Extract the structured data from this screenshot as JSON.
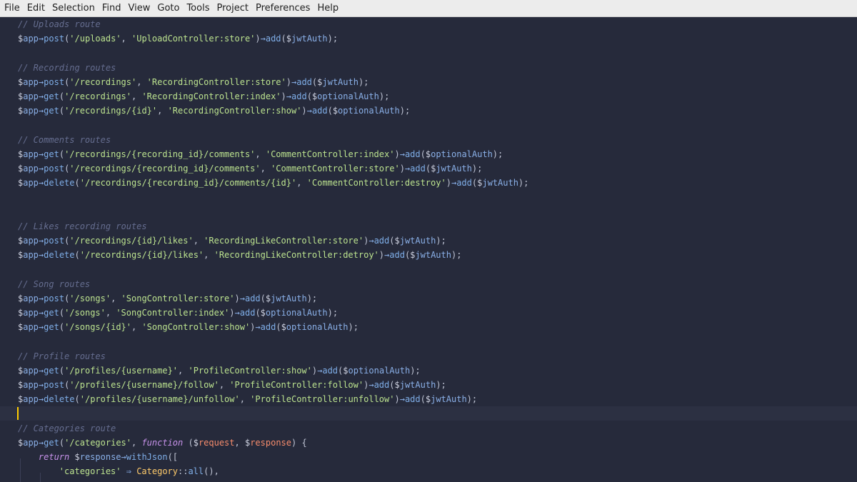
{
  "menu": [
    "File",
    "Edit",
    "Selection",
    "Find",
    "View",
    "Goto",
    "Tools",
    "Project",
    "Preferences",
    "Help"
  ],
  "colors": {
    "background": "#262a3b",
    "menubar": "#ececec",
    "comment": "#656d8f",
    "string": "#bce38f",
    "function": "#7faee8",
    "keyword": "#c792ea",
    "class": "#ffcb6b",
    "parameter": "#f78c6c",
    "cursor": "#ffcc00"
  },
  "code": [
    [
      [
        "c",
        "// Uploads route"
      ]
    ],
    [
      [
        "d",
        "$"
      ],
      [
        "v",
        "app"
      ],
      [
        "a",
        "→"
      ],
      [
        "f",
        "post"
      ],
      [
        "p",
        "("
      ],
      [
        "s",
        "'/uploads'"
      ],
      [
        "p",
        ", "
      ],
      [
        "s",
        "'UploadController:store'"
      ],
      [
        "p",
        ")"
      ],
      [
        "a",
        "→"
      ],
      [
        "f",
        "add"
      ],
      [
        "p",
        "("
      ],
      [
        "d",
        "$"
      ],
      [
        "v",
        "jwtAuth"
      ],
      [
        "p",
        ");"
      ]
    ],
    [],
    [
      [
        "c",
        "// Recording routes"
      ]
    ],
    [
      [
        "d",
        "$"
      ],
      [
        "v",
        "app"
      ],
      [
        "a",
        "→"
      ],
      [
        "f",
        "post"
      ],
      [
        "p",
        "("
      ],
      [
        "s",
        "'/recordings'"
      ],
      [
        "p",
        ", "
      ],
      [
        "s",
        "'RecordingController:store'"
      ],
      [
        "p",
        ")"
      ],
      [
        "a",
        "→"
      ],
      [
        "f",
        "add"
      ],
      [
        "p",
        "("
      ],
      [
        "d",
        "$"
      ],
      [
        "v",
        "jwtAuth"
      ],
      [
        "p",
        ");"
      ]
    ],
    [
      [
        "d",
        "$"
      ],
      [
        "v",
        "app"
      ],
      [
        "a",
        "→"
      ],
      [
        "f",
        "get"
      ],
      [
        "p",
        "("
      ],
      [
        "s",
        "'/recordings'"
      ],
      [
        "p",
        ", "
      ],
      [
        "s",
        "'RecordingController:index'"
      ],
      [
        "p",
        ")"
      ],
      [
        "a",
        "→"
      ],
      [
        "f",
        "add"
      ],
      [
        "p",
        "("
      ],
      [
        "d",
        "$"
      ],
      [
        "v",
        "optionalAuth"
      ],
      [
        "p",
        ");"
      ]
    ],
    [
      [
        "d",
        "$"
      ],
      [
        "v",
        "app"
      ],
      [
        "a",
        "→"
      ],
      [
        "f",
        "get"
      ],
      [
        "p",
        "("
      ],
      [
        "s",
        "'/recordings/{id}'"
      ],
      [
        "p",
        ", "
      ],
      [
        "s",
        "'RecordingController:show'"
      ],
      [
        "p",
        ")"
      ],
      [
        "a",
        "→"
      ],
      [
        "f",
        "add"
      ],
      [
        "p",
        "("
      ],
      [
        "d",
        "$"
      ],
      [
        "v",
        "optionalAuth"
      ],
      [
        "p",
        ");"
      ]
    ],
    [],
    [
      [
        "c",
        "// Comments routes"
      ]
    ],
    [
      [
        "d",
        "$"
      ],
      [
        "v",
        "app"
      ],
      [
        "a",
        "→"
      ],
      [
        "f",
        "get"
      ],
      [
        "p",
        "("
      ],
      [
        "s",
        "'/recordings/{recording_id}/comments'"
      ],
      [
        "p",
        ", "
      ],
      [
        "s",
        "'CommentController:index'"
      ],
      [
        "p",
        ")"
      ],
      [
        "a",
        "→"
      ],
      [
        "f",
        "add"
      ],
      [
        "p",
        "("
      ],
      [
        "d",
        "$"
      ],
      [
        "v",
        "optionalAuth"
      ],
      [
        "p",
        ");"
      ]
    ],
    [
      [
        "d",
        "$"
      ],
      [
        "v",
        "app"
      ],
      [
        "a",
        "→"
      ],
      [
        "f",
        "post"
      ],
      [
        "p",
        "("
      ],
      [
        "s",
        "'/recordings/{recording_id}/comments'"
      ],
      [
        "p",
        ", "
      ],
      [
        "s",
        "'CommentController:store'"
      ],
      [
        "p",
        ")"
      ],
      [
        "a",
        "→"
      ],
      [
        "f",
        "add"
      ],
      [
        "p",
        "("
      ],
      [
        "d",
        "$"
      ],
      [
        "v",
        "jwtAuth"
      ],
      [
        "p",
        ");"
      ]
    ],
    [
      [
        "d",
        "$"
      ],
      [
        "v",
        "app"
      ],
      [
        "a",
        "→"
      ],
      [
        "f",
        "delete"
      ],
      [
        "p",
        "("
      ],
      [
        "s",
        "'/recordings/{recording_id}/comments/{id}'"
      ],
      [
        "p",
        ", "
      ],
      [
        "s",
        "'CommentController:destroy'"
      ],
      [
        "p",
        ")"
      ],
      [
        "a",
        "→"
      ],
      [
        "f",
        "add"
      ],
      [
        "p",
        "("
      ],
      [
        "d",
        "$"
      ],
      [
        "v",
        "jwtAuth"
      ],
      [
        "p",
        ");"
      ]
    ],
    [],
    [],
    [
      [
        "c",
        "// Likes recording routes"
      ]
    ],
    [
      [
        "d",
        "$"
      ],
      [
        "v",
        "app"
      ],
      [
        "a",
        "→"
      ],
      [
        "f",
        "post"
      ],
      [
        "p",
        "("
      ],
      [
        "s",
        "'/recordings/{id}/likes'"
      ],
      [
        "p",
        ", "
      ],
      [
        "s",
        "'RecordingLikeController:store'"
      ],
      [
        "p",
        ")"
      ],
      [
        "a",
        "→"
      ],
      [
        "f",
        "add"
      ],
      [
        "p",
        "("
      ],
      [
        "d",
        "$"
      ],
      [
        "v",
        "jwtAuth"
      ],
      [
        "p",
        ");"
      ]
    ],
    [
      [
        "d",
        "$"
      ],
      [
        "v",
        "app"
      ],
      [
        "a",
        "→"
      ],
      [
        "f",
        "delete"
      ],
      [
        "p",
        "("
      ],
      [
        "s",
        "'/recordings/{id}/likes'"
      ],
      [
        "p",
        ", "
      ],
      [
        "s",
        "'RecordingLikeController:detroy'"
      ],
      [
        "p",
        ")"
      ],
      [
        "a",
        "→"
      ],
      [
        "f",
        "add"
      ],
      [
        "p",
        "("
      ],
      [
        "d",
        "$"
      ],
      [
        "v",
        "jwtAuth"
      ],
      [
        "p",
        ");"
      ]
    ],
    [],
    [
      [
        "c",
        "// Song routes"
      ]
    ],
    [
      [
        "d",
        "$"
      ],
      [
        "v",
        "app"
      ],
      [
        "a",
        "→"
      ],
      [
        "f",
        "post"
      ],
      [
        "p",
        "("
      ],
      [
        "s",
        "'/songs'"
      ],
      [
        "p",
        ", "
      ],
      [
        "s",
        "'SongController:store'"
      ],
      [
        "p",
        ")"
      ],
      [
        "a",
        "→"
      ],
      [
        "f",
        "add"
      ],
      [
        "p",
        "("
      ],
      [
        "d",
        "$"
      ],
      [
        "v",
        "jwtAuth"
      ],
      [
        "p",
        ");"
      ]
    ],
    [
      [
        "d",
        "$"
      ],
      [
        "v",
        "app"
      ],
      [
        "a",
        "→"
      ],
      [
        "f",
        "get"
      ],
      [
        "p",
        "("
      ],
      [
        "s",
        "'/songs'"
      ],
      [
        "p",
        ", "
      ],
      [
        "s",
        "'SongController:index'"
      ],
      [
        "p",
        ")"
      ],
      [
        "a",
        "→"
      ],
      [
        "f",
        "add"
      ],
      [
        "p",
        "("
      ],
      [
        "d",
        "$"
      ],
      [
        "v",
        "optionalAuth"
      ],
      [
        "p",
        ");"
      ]
    ],
    [
      [
        "d",
        "$"
      ],
      [
        "v",
        "app"
      ],
      [
        "a",
        "→"
      ],
      [
        "f",
        "get"
      ],
      [
        "p",
        "("
      ],
      [
        "s",
        "'/songs/{id}'"
      ],
      [
        "p",
        ", "
      ],
      [
        "s",
        "'SongController:show'"
      ],
      [
        "p",
        ")"
      ],
      [
        "a",
        "→"
      ],
      [
        "f",
        "add"
      ],
      [
        "p",
        "("
      ],
      [
        "d",
        "$"
      ],
      [
        "v",
        "optionalAuth"
      ],
      [
        "p",
        ");"
      ]
    ],
    [],
    [
      [
        "c",
        "// Profile routes"
      ]
    ],
    [
      [
        "d",
        "$"
      ],
      [
        "v",
        "app"
      ],
      [
        "a",
        "→"
      ],
      [
        "f",
        "get"
      ],
      [
        "p",
        "("
      ],
      [
        "s",
        "'/profiles/{username}'"
      ],
      [
        "p",
        ", "
      ],
      [
        "s",
        "'ProfileController:show'"
      ],
      [
        "p",
        ")"
      ],
      [
        "a",
        "→"
      ],
      [
        "f",
        "add"
      ],
      [
        "p",
        "("
      ],
      [
        "d",
        "$"
      ],
      [
        "v",
        "optionalAuth"
      ],
      [
        "p",
        ");"
      ]
    ],
    [
      [
        "d",
        "$"
      ],
      [
        "v",
        "app"
      ],
      [
        "a",
        "→"
      ],
      [
        "f",
        "post"
      ],
      [
        "p",
        "("
      ],
      [
        "s",
        "'/profiles/{username}/follow'"
      ],
      [
        "p",
        ", "
      ],
      [
        "s",
        "'ProfileController:follow'"
      ],
      [
        "p",
        ")"
      ],
      [
        "a",
        "→"
      ],
      [
        "f",
        "add"
      ],
      [
        "p",
        "("
      ],
      [
        "d",
        "$"
      ],
      [
        "v",
        "jwtAuth"
      ],
      [
        "p",
        ");"
      ]
    ],
    [
      [
        "d",
        "$"
      ],
      [
        "v",
        "app"
      ],
      [
        "a",
        "→"
      ],
      [
        "f",
        "delete"
      ],
      [
        "p",
        "("
      ],
      [
        "s",
        "'/profiles/{username}/unfollow'"
      ],
      [
        "p",
        ", "
      ],
      [
        "s",
        "'ProfileController:unfollow'"
      ],
      [
        "p",
        ")"
      ],
      [
        "a",
        "→"
      ],
      [
        "f",
        "add"
      ],
      [
        "p",
        "("
      ],
      [
        "d",
        "$"
      ],
      [
        "v",
        "jwtAuth"
      ],
      [
        "p",
        ");"
      ]
    ],
    [],
    [
      [
        "c",
        "// Categories route"
      ]
    ],
    [
      [
        "d",
        "$"
      ],
      [
        "v",
        "app"
      ],
      [
        "a",
        "→"
      ],
      [
        "f",
        "get"
      ],
      [
        "p",
        "("
      ],
      [
        "s",
        "'/categories'"
      ],
      [
        "p",
        ", "
      ],
      [
        "k",
        "function"
      ],
      [
        "p",
        " ("
      ],
      [
        "d",
        "$"
      ],
      [
        "r",
        "request"
      ],
      [
        "p",
        ", "
      ],
      [
        "d",
        "$"
      ],
      [
        "r",
        "response"
      ],
      [
        "p",
        ") {"
      ]
    ],
    [
      [
        "p",
        "    "
      ],
      [
        "k",
        "return"
      ],
      [
        "p",
        " "
      ],
      [
        "d",
        "$"
      ],
      [
        "v",
        "response"
      ],
      [
        "a",
        "→"
      ],
      [
        "f",
        "withJson"
      ],
      [
        "p",
        "(["
      ]
    ],
    [
      [
        "p",
        "        "
      ],
      [
        "s",
        "'categories'"
      ],
      [
        "p",
        " "
      ],
      [
        "a",
        "⇒"
      ],
      [
        "p",
        " "
      ],
      [
        "y",
        "Category"
      ],
      [
        "p",
        "::"
      ],
      [
        "f",
        "all"
      ],
      [
        "p",
        "(),"
      ]
    ]
  ],
  "current_line": 27
}
